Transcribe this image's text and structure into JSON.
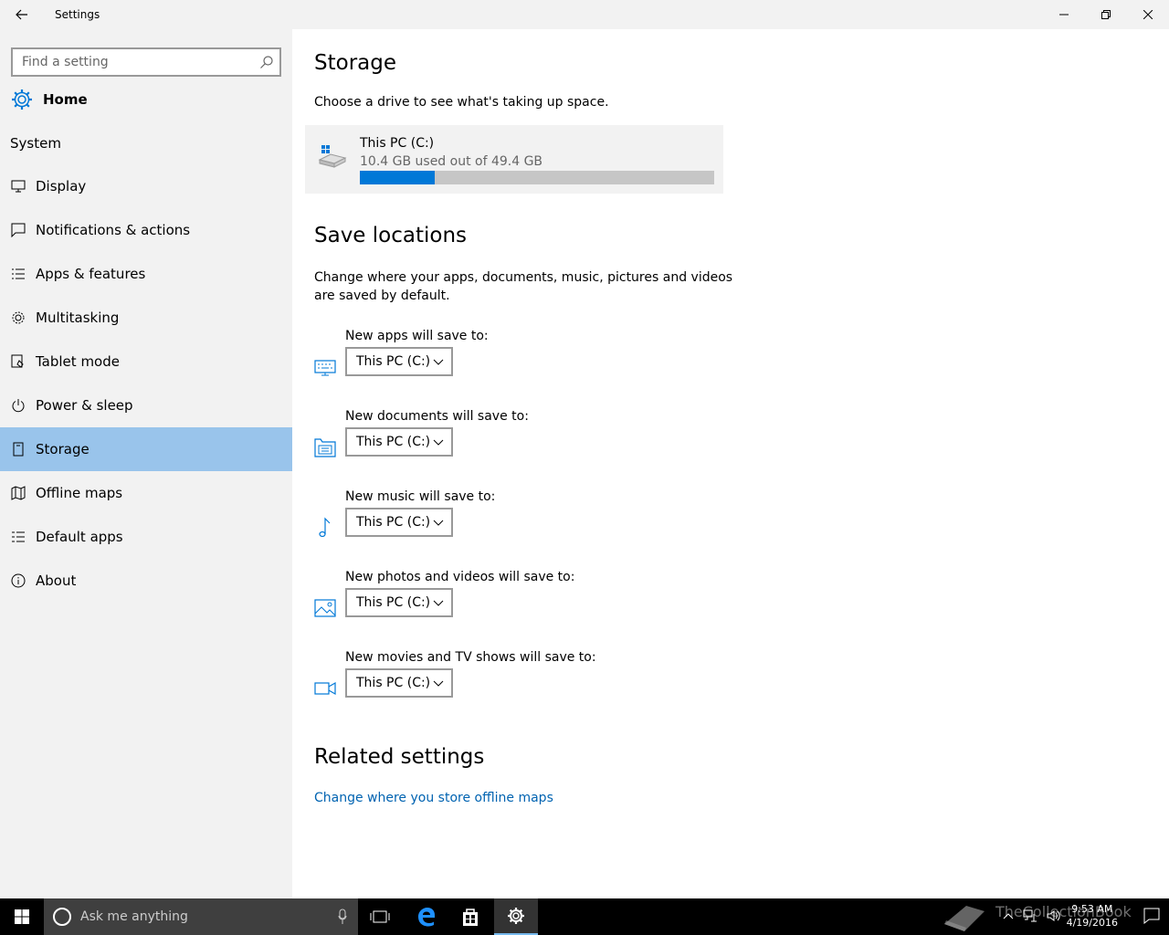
{
  "window": {
    "title": "Settings"
  },
  "sidebar": {
    "search_placeholder": "Find a setting",
    "home_label": "Home",
    "section_label": "System",
    "items": [
      {
        "label": "Display",
        "icon": "monitor-icon"
      },
      {
        "label": "Notifications & actions",
        "icon": "notification-icon"
      },
      {
        "label": "Apps & features",
        "icon": "list-icon"
      },
      {
        "label": "Multitasking",
        "icon": "multitasking-icon"
      },
      {
        "label": "Tablet mode",
        "icon": "tablet-icon"
      },
      {
        "label": "Power & sleep",
        "icon": "power-icon"
      },
      {
        "label": "Storage",
        "icon": "storage-icon",
        "selected": true
      },
      {
        "label": "Offline maps",
        "icon": "map-icon"
      },
      {
        "label": "Default apps",
        "icon": "default-apps-icon"
      },
      {
        "label": "About",
        "icon": "info-icon"
      }
    ]
  },
  "main": {
    "title": "Storage",
    "description": "Choose a drive to see what's taking up space.",
    "drive": {
      "name": "This PC (C:)",
      "usage": "10.4 GB used out of 49.4 GB",
      "used_gb": 10.4,
      "total_gb": 49.4
    },
    "save_locations": {
      "title": "Save locations",
      "description": "Change where your apps, documents, music, pictures and videos are saved by default.",
      "items": [
        {
          "label": "New apps will save to:",
          "value": "This PC (C:)",
          "icon": "apps-icon"
        },
        {
          "label": "New documents will save to:",
          "value": "This PC (C:)",
          "icon": "documents-icon"
        },
        {
          "label": "New music will save to:",
          "value": "This PC (C:)",
          "icon": "music-icon"
        },
        {
          "label": "New photos and videos will save to:",
          "value": "This PC (C:)",
          "icon": "photos-icon"
        },
        {
          "label": "New movies and TV shows will save to:",
          "value": "This PC (C:)",
          "icon": "video-icon"
        }
      ]
    },
    "related": {
      "title": "Related settings",
      "link": "Change where you store offline maps"
    }
  },
  "taskbar": {
    "search_placeholder": "Ask me anything",
    "time": "9:53 AM",
    "date": "4/19/2016",
    "watermark": "TheCollectionBook"
  },
  "colors": {
    "accent": "#0078d7",
    "selected_bg": "#99c4eb",
    "link": "#0063b1"
  }
}
